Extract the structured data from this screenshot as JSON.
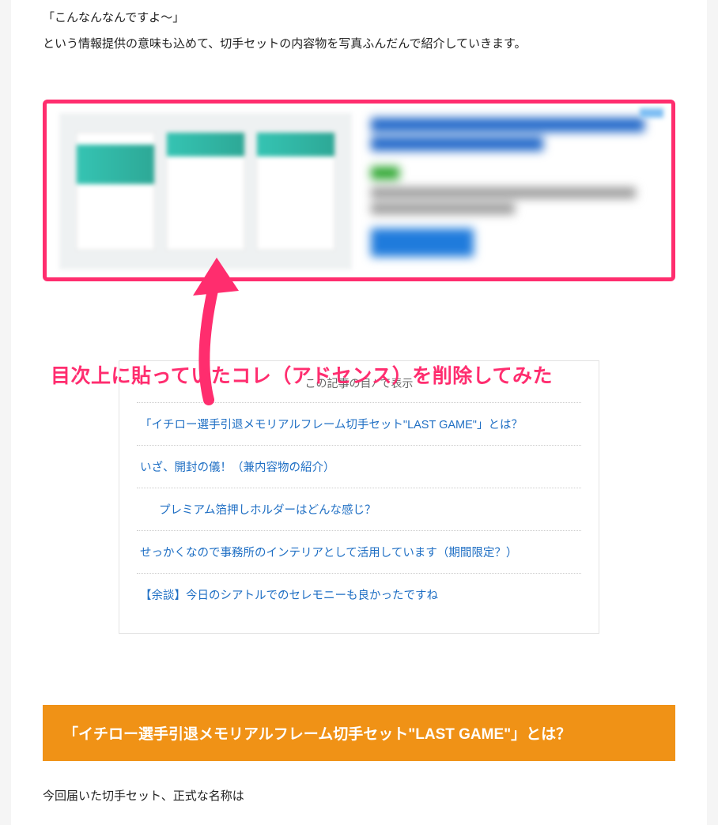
{
  "intro": {
    "line1": "「こんなんなんですよ〜」",
    "line2": "という情報提供の意味も込めて、切手セットの内容物を写真ふんだんで紹介していきます。"
  },
  "annotation": "目次上に貼っていたコレ（アドセンス）を削除してみた",
  "toc": {
    "header": "この記事の目ﾉ        で表示",
    "items": [
      {
        "label": "「イチロー選手引退メモリアルフレーム切手セット\"LAST GAME\"」とは？",
        "indent": false
      },
      {
        "label": "いざ、開封の儀！（兼内容物の紹介）",
        "indent": false
      },
      {
        "label": "プレミアム箔押しホルダーはどんな感じ？",
        "indent": true
      },
      {
        "label": "せっかくなので事務所のインテリアとして活用しています（期間限定？）",
        "indent": false
      },
      {
        "label": "【余談】今日のシアトルでのセレモニーも良かったですね",
        "indent": false
      }
    ]
  },
  "heading": "「イチロー選手引退メモリアルフレーム切手セット\"LAST GAME\"」とは？",
  "closing": "今回届いた切手セット、正式な名称は"
}
